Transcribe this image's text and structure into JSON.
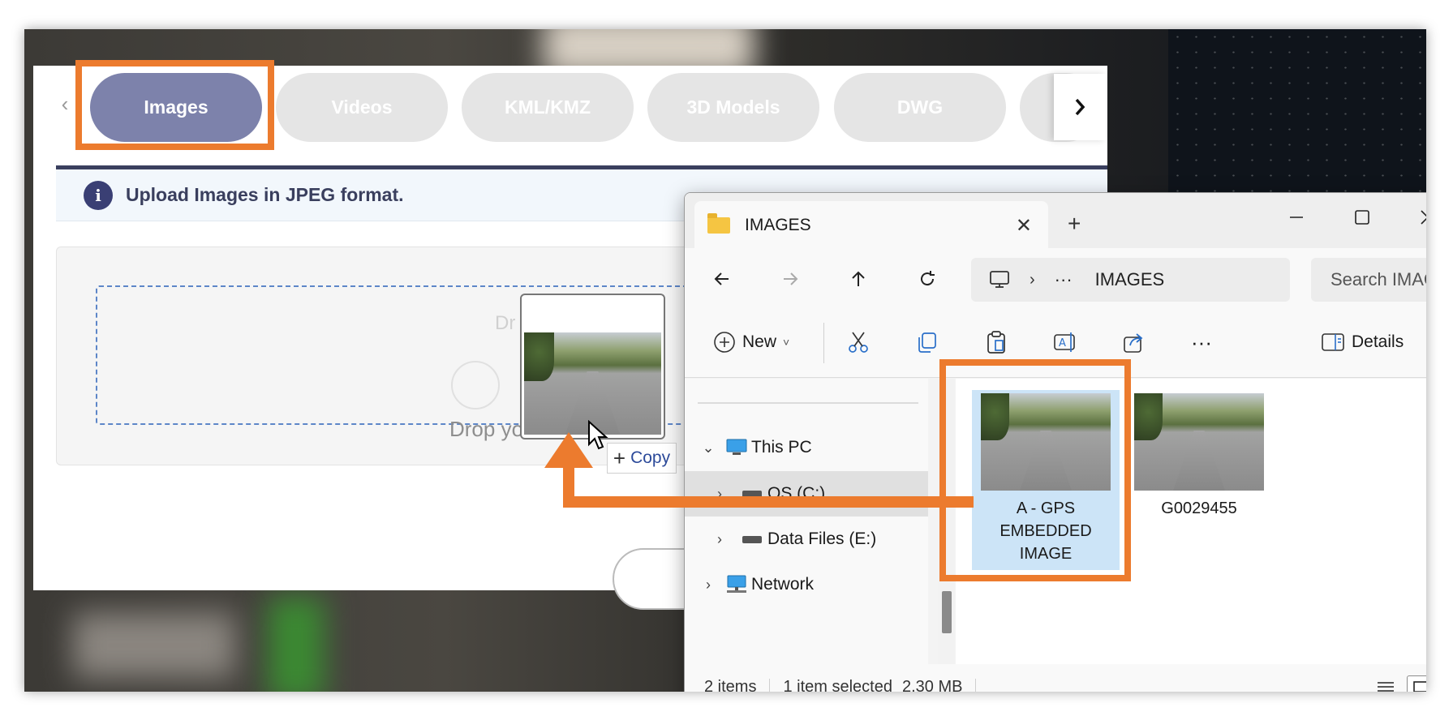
{
  "colors": {
    "accent_orange": "#ec7b2e",
    "active_tab": "#7d82ab",
    "info_icon": "#3a3f74",
    "selected_file": "#cce4f7"
  },
  "web": {
    "tabs": [
      {
        "label": "Images",
        "active": true
      },
      {
        "label": "Videos",
        "active": false
      },
      {
        "label": "KML/KMZ",
        "active": false
      },
      {
        "label": "3D Models",
        "active": false
      },
      {
        "label": "DWG",
        "active": false
      }
    ],
    "info_text": "Upload Images in JPEG format.",
    "drop_text": "Drop your fil",
    "copy_label": "Copy"
  },
  "explorer": {
    "tab_title": "IMAGES",
    "address_more": "···",
    "address_folder": "IMAGES",
    "search_placeholder": "Search IMAG",
    "toolbar": {
      "new_label": "New",
      "details_label": "Details",
      "more_label": "···"
    },
    "nav": [
      {
        "label": "This PC"
      },
      {
        "label": "OS (C:)"
      },
      {
        "label": "Data Files (E:)"
      },
      {
        "label": "Network"
      }
    ],
    "files": [
      {
        "name": "A - GPS EMBEDDED IMAGE",
        "selected": true
      },
      {
        "name": "G0029455",
        "selected": false
      }
    ],
    "status": {
      "items_count": "2 items",
      "selection": "1 item selected",
      "size": "2.30 MB"
    }
  }
}
